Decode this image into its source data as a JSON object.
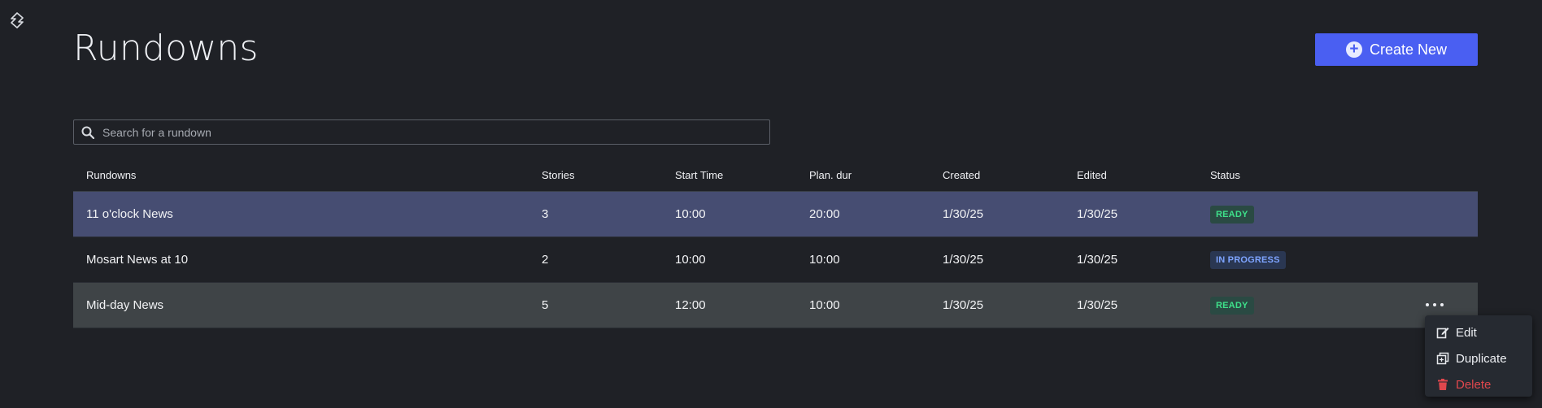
{
  "header": {
    "title": "Rundowns",
    "create_label": "Create New"
  },
  "search": {
    "placeholder": "Search for a rundown",
    "value": ""
  },
  "table": {
    "columns": [
      "Rundowns",
      "Stories",
      "Start Time",
      "Plan. dur",
      "Created",
      "Edited",
      "Status"
    ],
    "rows": [
      {
        "name": "11 o'clock News",
        "stories": "3",
        "start": "10:00",
        "plan": "20:00",
        "created": "1/30/25",
        "edited": "1/30/25",
        "status": "READY",
        "state": "selected"
      },
      {
        "name": "Mosart News at 10",
        "stories": "2",
        "start": "10:00",
        "plan": "10:00",
        "created": "1/30/25",
        "edited": "1/30/25",
        "status": "IN PROGRESS",
        "state": "normal"
      },
      {
        "name": "Mid-day News",
        "stories": "5",
        "start": "12:00",
        "plan": "10:00",
        "created": "1/30/25",
        "edited": "1/30/25",
        "status": "READY",
        "state": "hover"
      }
    ]
  },
  "context_menu": {
    "items": [
      {
        "label": "Edit",
        "icon": "edit-icon"
      },
      {
        "label": "Duplicate",
        "icon": "duplicate-icon"
      },
      {
        "label": "Delete",
        "icon": "trash-icon"
      }
    ]
  },
  "colors": {
    "background": "#1f2126",
    "accent": "#4a5ff2",
    "selected_row": "#464d72",
    "hover_row": "#3f4447",
    "ready": "#3ee08a",
    "in_progress": "#7ea4ff",
    "danger": "#e0474d"
  }
}
